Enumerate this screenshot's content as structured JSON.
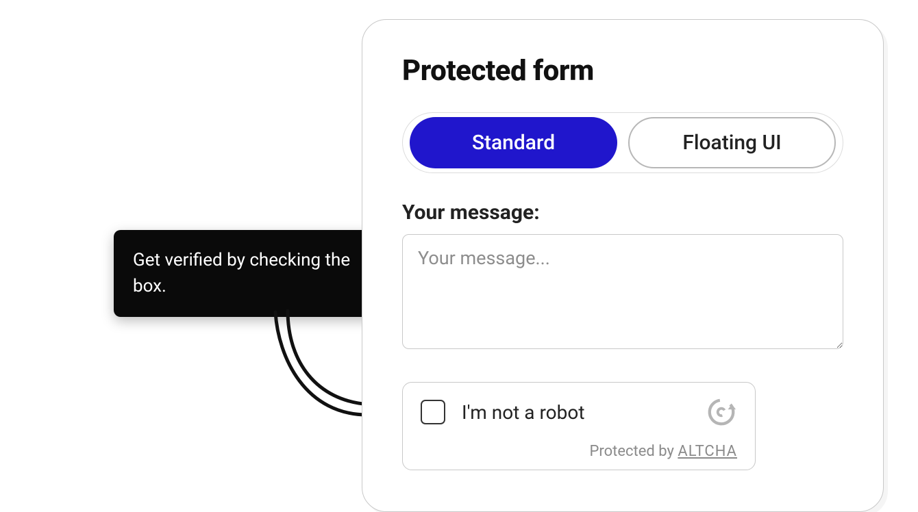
{
  "tooltip": {
    "text": "Get verified by checking the box."
  },
  "card": {
    "title": "Protected form",
    "tabs": [
      {
        "label": "Standard",
        "active": true
      },
      {
        "label": "Floating UI",
        "active": false
      }
    ],
    "message_label": "Your message:",
    "message_placeholder": "Your message...",
    "message_value": ""
  },
  "captcha": {
    "label": "I'm not a robot",
    "footer_prefix": "Protected by ",
    "footer_brand": "ALTCHA"
  }
}
